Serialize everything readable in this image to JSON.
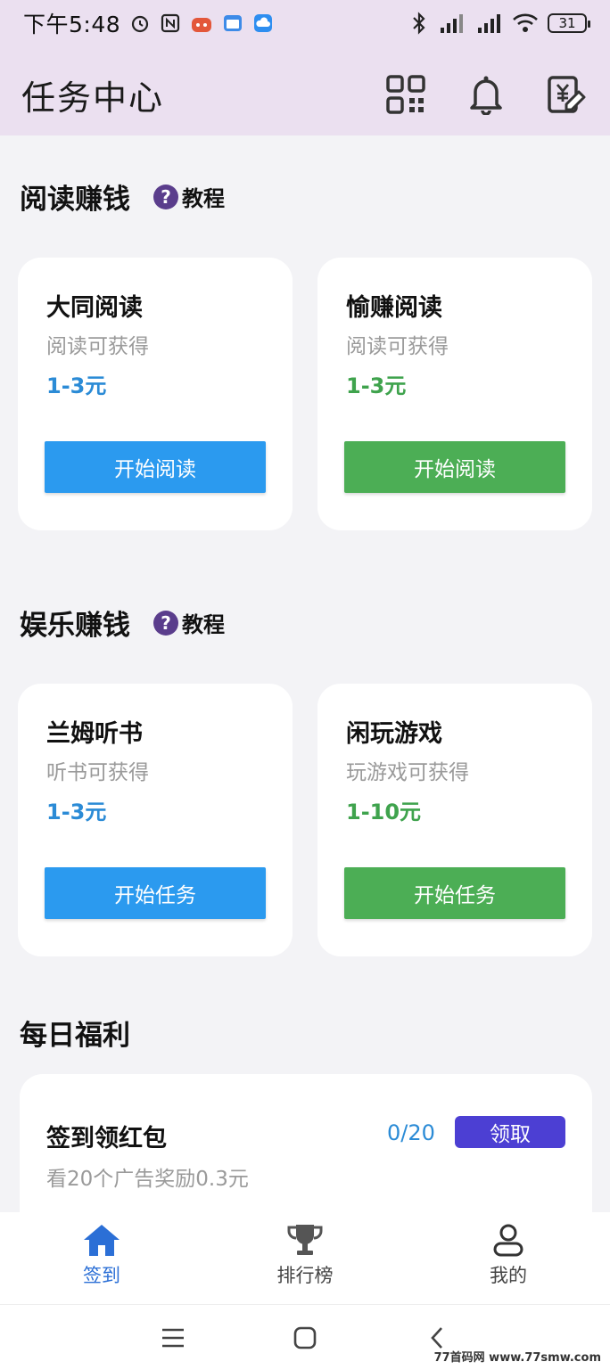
{
  "status_bar": {
    "time": "下午5:48",
    "battery": "31"
  },
  "header": {
    "title": "任务中心"
  },
  "reading": {
    "title": "阅读赚钱",
    "tutorial": "教程",
    "cards": [
      {
        "name": "大同阅读",
        "desc": "阅读可获得",
        "reward": "1-3元",
        "button": "开始阅读",
        "color": "#2b9aef"
      },
      {
        "name": "愉赚阅读",
        "desc": "阅读可获得",
        "reward": "1-3元",
        "button": "开始阅读",
        "color": "#4cae55"
      }
    ]
  },
  "entertainment": {
    "title": "娱乐赚钱",
    "tutorial": "教程",
    "cards": [
      {
        "name": "兰姆听书",
        "desc": "听书可获得",
        "reward": "1-3元",
        "button": "开始任务",
        "color": "#2b9aef"
      },
      {
        "name": "闲玩游戏",
        "desc": "玩游戏可获得",
        "reward": "1-10元",
        "button": "开始任务",
        "color": "#4cae55"
      }
    ]
  },
  "daily": {
    "title": "每日福利",
    "task": {
      "name": "签到领红包",
      "desc": "看20个广告奖励0.3元",
      "progress": "0/20",
      "button": "领取"
    }
  },
  "tabbar": {
    "items": [
      {
        "label": "签到",
        "icon": "home-icon"
      },
      {
        "label": "排行榜",
        "icon": "trophy-icon"
      },
      {
        "label": "我的",
        "icon": "user-icon"
      }
    ]
  },
  "watermark": "77首码网 www.77smw.com"
}
